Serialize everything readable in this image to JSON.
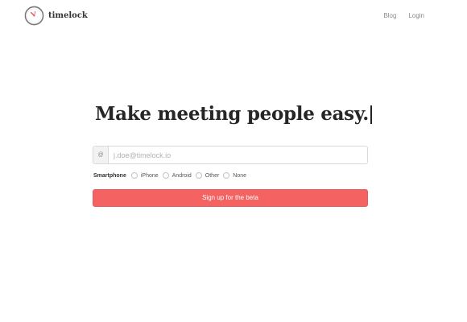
{
  "brand": {
    "name": "timelock",
    "accent_color": "#f56262"
  },
  "nav": {
    "blog": "Blog",
    "login": "Login"
  },
  "hero": {
    "headline": "Make meeting people easy."
  },
  "signup_form": {
    "email_icon": "at-icon",
    "email_icon_glyph": "@",
    "email_placeholder": "j.doe@timelock.io",
    "email_value": "",
    "smartphone_label": "Smartphone",
    "smartphone_options": [
      {
        "label": "iPhone",
        "checked": false
      },
      {
        "label": "Android",
        "checked": false
      },
      {
        "label": "Other",
        "checked": false
      },
      {
        "label": "None",
        "checked": false
      }
    ],
    "submit_label": "Sign up for the beta"
  }
}
